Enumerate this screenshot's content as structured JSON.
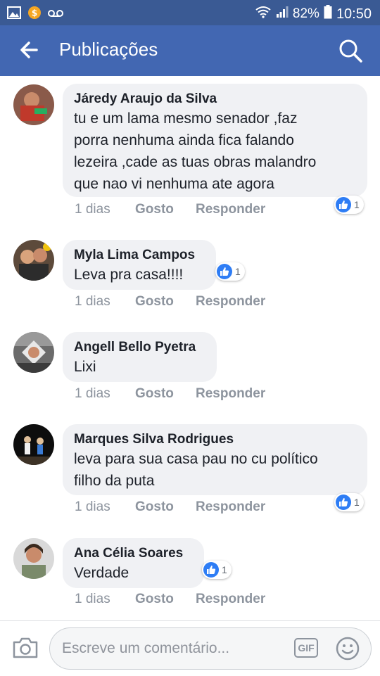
{
  "status_bar": {
    "battery": "82%",
    "time": "10:50",
    "icons": [
      "image-icon",
      "coin-icon",
      "voicemail-icon",
      "wifi-icon",
      "signal-icon",
      "battery-icon"
    ]
  },
  "header": {
    "title": "Publicações",
    "back_icon": "back-arrow-icon",
    "search_icon": "search-icon",
    "color": "#4267b2"
  },
  "comments": [
    {
      "author": "Járedy Araujo da Silva",
      "lines": [
        "tu e um lama mesmo senador ,faz",
        "porra nenhuma ainda fica falando",
        "lezeira ,cade as tuas obras malandro",
        "que nao vi nenhuma ate agora"
      ],
      "time": "1 dias",
      "like_label": "Gosto",
      "reply_label": "Responder",
      "reactions": "1"
    },
    {
      "author": "Myla Lima Campos",
      "lines": [
        "Leva pra casa!!!!"
      ],
      "time": "1 dias",
      "like_label": "Gosto",
      "reply_label": "Responder",
      "reactions": "1"
    },
    {
      "author": "Angell Bello Pyetra",
      "lines": [
        "Lixi"
      ],
      "time": "1 dias",
      "like_label": "Gosto",
      "reply_label": "Responder",
      "reactions": ""
    },
    {
      "author": "Marques Silva Rodrigues",
      "lines": [
        "leva para sua casa pau no cu político",
        "filho da puta"
      ],
      "time": "1 dias",
      "like_label": "Gosto",
      "reply_label": "Responder",
      "reactions": "1"
    },
    {
      "author": "Ana Célia Soares",
      "lines": [
        "Verdade"
      ],
      "time": "1 dias",
      "like_label": "Gosto",
      "reply_label": "Responder",
      "reactions": "1"
    }
  ],
  "composer": {
    "placeholder": "Escreve um comentário...",
    "gif_label": "GIF",
    "camera_icon": "camera-icon",
    "emoji_icon": "emoji-icon"
  },
  "colors": {
    "like_blue": "#2e7df5",
    "bubble": "#f0f1f4",
    "status_bar": "#3a5a94"
  }
}
